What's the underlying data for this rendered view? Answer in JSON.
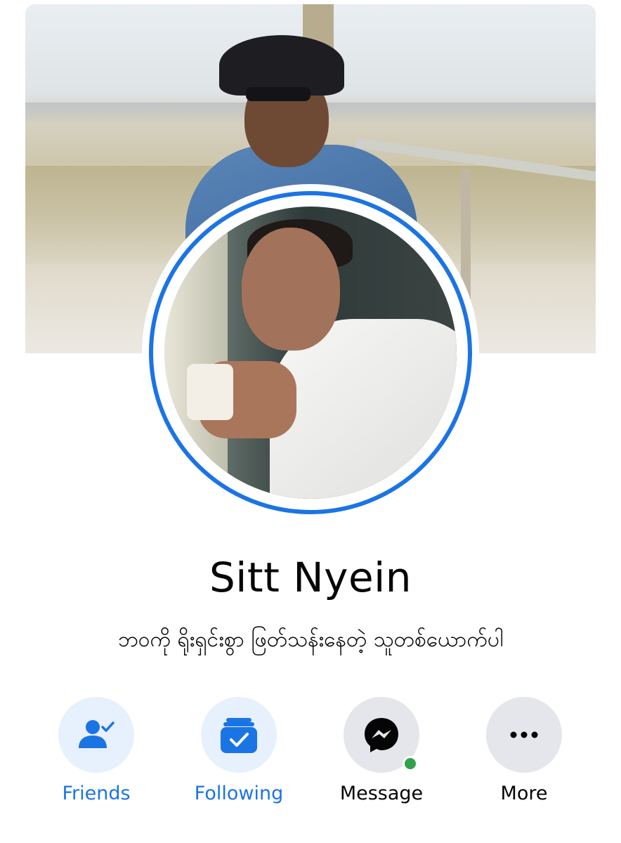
{
  "profile": {
    "name": "Sitt Nyein",
    "bio": "ဘဝကို ရိုးရှင်းစွာ ဖြတ်သန်းနေတဲ့ သူတစ်ယောက်ပါ"
  },
  "actions": [
    {
      "label": "Friends",
      "icon": "friend-check-icon"
    },
    {
      "label": "Following",
      "icon": "following-check-icon"
    },
    {
      "label": "Message",
      "icon": "messenger-icon"
    },
    {
      "label": "More",
      "icon": "more-dots-icon"
    }
  ],
  "colors": {
    "accent": "#1b74e4",
    "accent_light": "#e7f0fd",
    "neutral_button": "#e4e6eb",
    "online": "#31a24c"
  }
}
